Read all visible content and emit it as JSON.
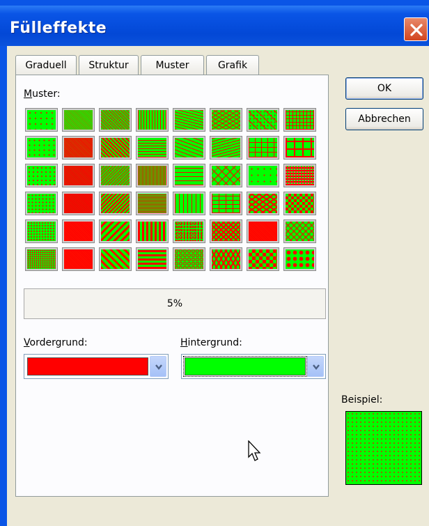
{
  "window": {
    "title": "Fülleffekte"
  },
  "tabs": [
    {
      "label": "Graduell",
      "active": false
    },
    {
      "label": "Struktur",
      "active": false
    },
    {
      "label": "Muster",
      "active": true
    },
    {
      "label": "Grafik",
      "active": false
    }
  ],
  "buttons": {
    "ok": "OK",
    "cancel": "Abbrechen"
  },
  "pattern": {
    "label_underlined": "M",
    "label_rest": "uster:",
    "selected_name": "5%",
    "foreground_color": "#ff0000",
    "background_color": "#00ff00",
    "swatch_types": [
      "dots5",
      "dense50",
      "diagR",
      "vert",
      "wave",
      "zigzag",
      "dotcross",
      "grid",
      "dots10",
      "dense60",
      "diagRw",
      "horiz",
      "dashdiag",
      "sine",
      "smallgrid",
      "biggrid",
      "dots20",
      "dense70",
      "diagL",
      "vertL",
      "dashh",
      "weave",
      "dotsRand",
      "plaid",
      "dots25",
      "dense75",
      "diagLw",
      "horizL",
      "dashv",
      "brick",
      "zigzagb",
      "checker",
      "dots30",
      "dense80",
      "diagWideR",
      "vertW",
      "confetti",
      "trellis",
      "dense90",
      "diamondLine",
      "dots40",
      "dense90b",
      "diagWideL",
      "horizW",
      "sphere",
      "divot",
      "solidChk",
      "diamondDot"
    ]
  },
  "foreground": {
    "label_underlined": "V",
    "label_rest": "ordergrund:",
    "color": "#ff0000"
  },
  "background": {
    "label_underlined": "H",
    "label_rest": "intergrund:",
    "color": "#00ff00"
  },
  "sample": {
    "label": "Beispiel:"
  },
  "icons": [
    "close-icon",
    "chevron-down-icon",
    "mouse-pointer-icon"
  ]
}
